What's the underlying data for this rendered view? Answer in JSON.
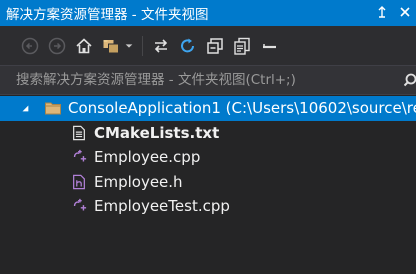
{
  "window": {
    "title": "解决方案资源管理器 - 文件夹视图"
  },
  "toolbar": {
    "icons": [
      "back-icon",
      "forward-icon",
      "home-icon",
      "switch-views-icon",
      "dropdown-icon",
      "sync-icon",
      "refresh-icon",
      "collapse-all-icon",
      "show-all-files-icon",
      "minus-icon"
    ]
  },
  "search": {
    "placeholder": "搜索解决方案资源管理器 - 文件夹视图(Ctrl+;)"
  },
  "tree": {
    "root": "ConsoleApplication1 (C:\\Users\\10602\\source\\re",
    "items": [
      {
        "label": "CMakeLists.txt",
        "icon": "text-file-icon"
      },
      {
        "label": "Employee.cpp",
        "icon": "cpp-file-icon"
      },
      {
        "label": "Employee.h",
        "icon": "header-file-icon"
      },
      {
        "label": "EmployeeTest.cpp",
        "icon": "cpp-file-icon"
      }
    ]
  },
  "colors": {
    "accent": "#007acc",
    "background": "#252526",
    "cpp": "#b180d7"
  }
}
